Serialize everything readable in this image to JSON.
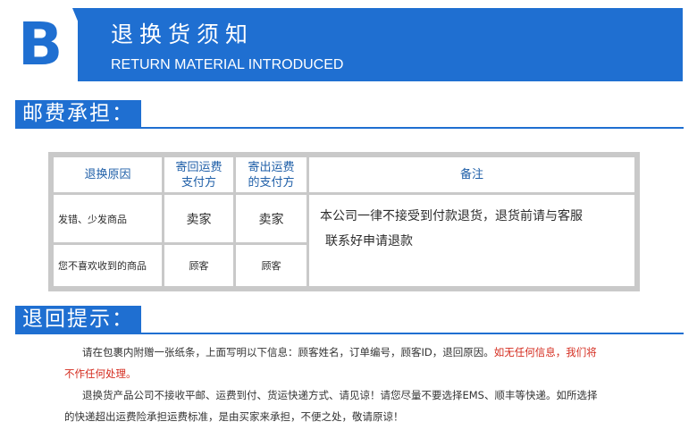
{
  "banner": {
    "letter": "B",
    "title_cn": "退换货须知",
    "title_en": "RETURN MATERIAL INTRODUCED"
  },
  "postage_section": {
    "heading": "邮费承担："
  },
  "table": {
    "headers": {
      "reason": "退换原因",
      "return_payer": [
        "寄回运费",
        "支付方"
      ],
      "send_payer": [
        "寄出运费",
        "的支付方"
      ],
      "remark": "备注"
    },
    "rows": [
      {
        "reason": "发错、少发商品",
        "return_payer": "卖家",
        "send_payer": "卖家"
      },
      {
        "reason": "您不喜欢收到的商品",
        "return_payer": "顾客",
        "send_payer": "顾客"
      }
    ],
    "remark_lines": [
      "本公司一律不接受到付款退货，退货前请与客服",
      "联系好申请退款"
    ]
  },
  "return_section": {
    "heading": "退回提示："
  },
  "tips": {
    "p1_normal": "请在包裹内附赠一张纸条，上面写明以下信息：顾客姓名，订单编号，顾客ID，退回原因。",
    "p1_red_a": "如无任何信息，我们将",
    "p1_red_b": "不作任何处理。",
    "p2_line1": "退换货产品公司不接收平邮、运费到付、货运快递方式、请见谅！请您尽量不要选择EMS、顺丰等快递。如所选择",
    "p2_line2": "的快递超出运费险承担运费标准，是由买家来承担，不便之处，敬请原谅！"
  },
  "colors": {
    "brand_blue": "#1f6fd1",
    "header_text": "#1f5fa8",
    "warning_red": "#d42b1e"
  }
}
